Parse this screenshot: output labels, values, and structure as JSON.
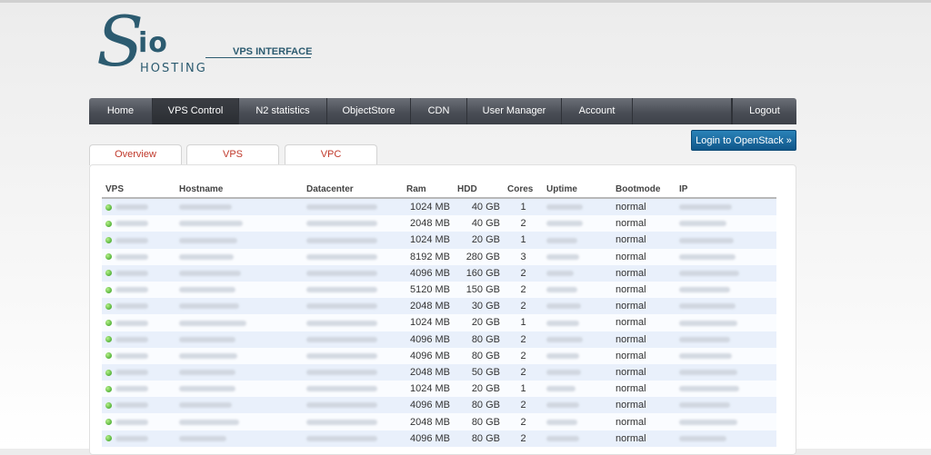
{
  "logo": {
    "big_letter": "S",
    "io": "io",
    "hosting": "HOSTING",
    "subtitle": "VPS INTERFACE"
  },
  "nav": {
    "items": [
      {
        "label": "Home",
        "active": false
      },
      {
        "label": "VPS Control",
        "active": true
      },
      {
        "label": "N2 statistics",
        "active": false
      },
      {
        "label": "ObjectStore",
        "active": false
      },
      {
        "label": "CDN",
        "active": false
      },
      {
        "label": "User Manager",
        "active": false
      },
      {
        "label": "Account",
        "active": false
      }
    ],
    "logout": "Logout"
  },
  "openstack_button": "Login to OpenStack »",
  "tabs": [
    "Overview",
    "VPS",
    "VPC"
  ],
  "table": {
    "headers": [
      "VPS",
      "Hostname",
      "Datacenter",
      "Ram",
      "HDD",
      "Cores",
      "Uptime",
      "Bootmode",
      "IP"
    ],
    "rows": [
      {
        "ram": "1024 MB",
        "hdd": "40 GB",
        "cores": "1",
        "bootmode": "normal"
      },
      {
        "ram": "2048 MB",
        "hdd": "40 GB",
        "cores": "2",
        "bootmode": "normal"
      },
      {
        "ram": "1024 MB",
        "hdd": "20 GB",
        "cores": "1",
        "bootmode": "normal"
      },
      {
        "ram": "8192 MB",
        "hdd": "280 GB",
        "cores": "3",
        "bootmode": "normal"
      },
      {
        "ram": "4096 MB",
        "hdd": "160 GB",
        "cores": "2",
        "bootmode": "normal"
      },
      {
        "ram": "5120 MB",
        "hdd": "150 GB",
        "cores": "2",
        "bootmode": "normal"
      },
      {
        "ram": "2048 MB",
        "hdd": "30 GB",
        "cores": "2",
        "bootmode": "normal"
      },
      {
        "ram": "1024 MB",
        "hdd": "20 GB",
        "cores": "1",
        "bootmode": "normal"
      },
      {
        "ram": "4096 MB",
        "hdd": "80 GB",
        "cores": "2",
        "bootmode": "normal"
      },
      {
        "ram": "4096 MB",
        "hdd": "80 GB",
        "cores": "2",
        "bootmode": "normal"
      },
      {
        "ram": "2048 MB",
        "hdd": "50 GB",
        "cores": "2",
        "bootmode": "normal"
      },
      {
        "ram": "1024 MB",
        "hdd": "20 GB",
        "cores": "1",
        "bootmode": "normal"
      },
      {
        "ram": "4096 MB",
        "hdd": "80 GB",
        "cores": "2",
        "bootmode": "normal"
      },
      {
        "ram": "2048 MB",
        "hdd": "80 GB",
        "cores": "2",
        "bootmode": "normal"
      },
      {
        "ram": "4096 MB",
        "hdd": "80 GB",
        "cores": "2",
        "bootmode": "normal"
      }
    ]
  },
  "colors": {
    "brand": "#2c5b70",
    "nav_bg": "#4a4e56",
    "button": "#1a6ca3",
    "tab_text": "#c0392b",
    "row_alt": "#e9f0fb",
    "status_ok": "#2f9a1b"
  },
  "icons": {
    "status": "status-online-icon"
  }
}
